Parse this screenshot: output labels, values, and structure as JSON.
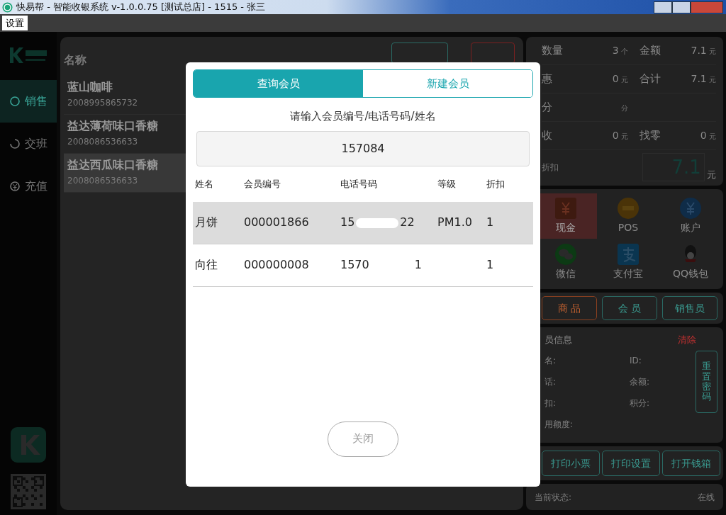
{
  "window": {
    "title": "快易帮 - 智能收银系统 v-1.0.0.75 [测试总店] - 1515 - 张三"
  },
  "menu": [
    "设置"
  ],
  "sidebar": {
    "items": [
      {
        "label": "销售",
        "selected": true
      },
      {
        "label": "交班",
        "selected": false
      },
      {
        "label": "充值",
        "selected": false
      }
    ]
  },
  "cart": {
    "columns": [
      "名称"
    ],
    "buttons": [
      {
        "kind": "normal"
      },
      {
        "kind": "danger"
      }
    ],
    "items": [
      {
        "name": "蓝山咖啡",
        "code": "2008995865732",
        "selected": false
      },
      {
        "name": "益达薄荷味口香糖",
        "code": "2008086536633",
        "selected": false
      },
      {
        "name": "益达西瓜味口香糖",
        "code": "2008086536633",
        "selected": true
      }
    ]
  },
  "summary": {
    "rows": [
      [
        {
          "label": "数量",
          "value": "3",
          "unit": "个"
        },
        {
          "label": "金额",
          "value": "7.1",
          "unit": "元"
        }
      ],
      [
        {
          "label": "惠",
          "value": "0",
          "unit": "元"
        },
        {
          "label": "合计",
          "value": "7.1",
          "unit": "元"
        }
      ],
      [
        {
          "label": "分",
          "unit": "分"
        }
      ],
      [
        {
          "label": "收",
          "value": "0",
          "unit": "元"
        },
        {
          "label": "找零",
          "value": "0",
          "unit": "元"
        }
      ]
    ],
    "discount_note": "折扣",
    "due": {
      "value": "7.1",
      "unit": "元"
    }
  },
  "payments": [
    {
      "label": "现金",
      "kind": "cash",
      "selected": true
    },
    {
      "label": "POS",
      "kind": "pos",
      "selected": false
    },
    {
      "label": "账户",
      "kind": "account",
      "selected": false
    },
    {
      "label": "微信",
      "kind": "wechat",
      "selected": false
    },
    {
      "label": "支付宝",
      "kind": "alipay",
      "selected": false
    },
    {
      "label": "QQ钱包",
      "kind": "qq",
      "selected": false
    }
  ],
  "panel_tabs": [
    {
      "label": "商 品",
      "selected": true
    },
    {
      "label": "会 员",
      "selected": false
    },
    {
      "label": "销售员",
      "selected": false
    }
  ],
  "member_info": {
    "title": "员信息",
    "clear": "清除",
    "fields": [
      "名:",
      "ID:",
      "话:",
      "余额:",
      "扣:",
      "积分:",
      "用额度:"
    ],
    "reset_button": "重置密码"
  },
  "print_buttons": [
    "打印小票",
    "打印设置",
    "打开钱箱"
  ],
  "status": {
    "label": "当前状态:",
    "value": "在线"
  },
  "dialog": {
    "tabs": [
      {
        "label": "查询会员",
        "selected": true
      },
      {
        "label": "新建会员",
        "selected": false
      }
    ],
    "prompt": "请输入会员编号/电话号码/姓名",
    "search_value": "157084",
    "columns": [
      "姓名",
      "会员编号",
      "电话号码",
      "等级",
      "折扣"
    ],
    "rows": [
      {
        "name": "月饼",
        "member_no": "000001866",
        "phone_start": "15",
        "phone_end": "22",
        "grade": "PM1.0",
        "discount": "1",
        "selected": true
      },
      {
        "name": "向往",
        "member_no": "000000008",
        "phone_start": "1570",
        "phone_end": "1",
        "discount": "1",
        "selected": false
      }
    ],
    "close": "关闭"
  }
}
